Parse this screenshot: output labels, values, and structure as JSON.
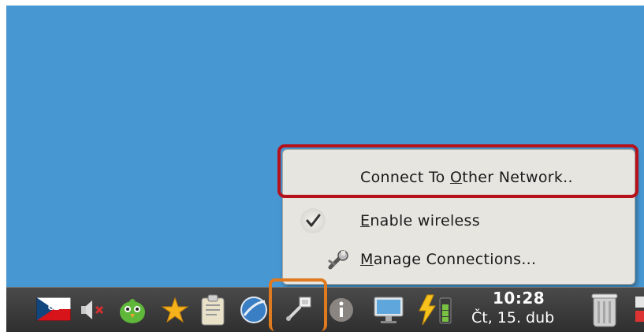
{
  "menu": {
    "items": [
      {
        "label": "Connect To Other Network..",
        "underline": "O"
      },
      {
        "label": "Enable wireless",
        "underline": "E",
        "checked": true
      },
      {
        "label": "Manage Connections...",
        "underline": "M"
      }
    ]
  },
  "taskbar": {
    "keyboard_layout": "CZ",
    "clock": {
      "time": "10:28",
      "date": "Čt, 15. dub"
    },
    "icons": [
      "keyboard-layout-icon",
      "volume-muted-icon",
      "messenger-icon",
      "favorites-star-icon",
      "clipboard-icon",
      "browser-icon",
      "network-icon",
      "info-icon",
      "display-icon",
      "power-icon",
      "trash-icon"
    ]
  },
  "colors": {
    "desktop": "#4797d2",
    "menu_highlight_outline": "#b5121b",
    "tray_highlight_outline": "#e07a1f"
  }
}
